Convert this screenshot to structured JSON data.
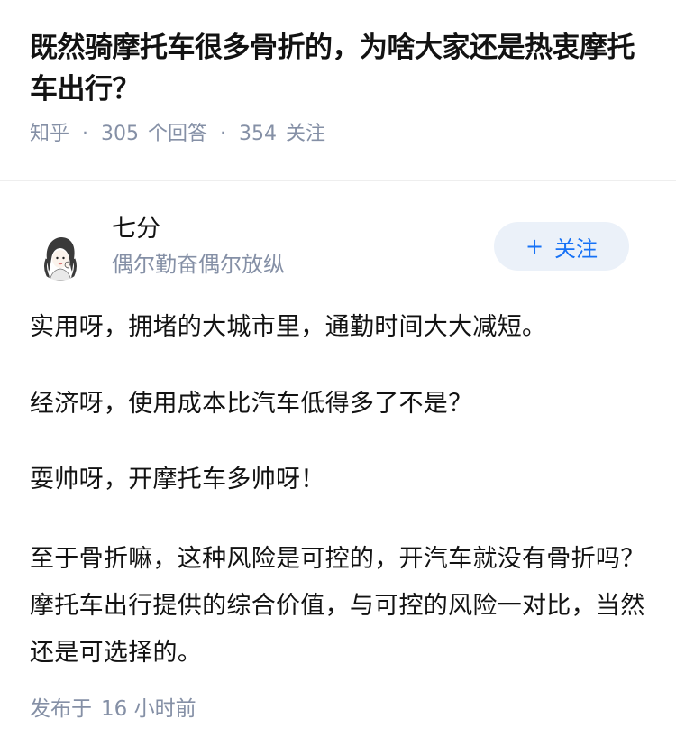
{
  "question": {
    "title": "既然骑摩托车很多骨折的，为啥大家还是热衷摩托车出行？",
    "source": "知乎",
    "answer_count": "305",
    "answer_label": "个回答",
    "follow_count": "354",
    "follow_label": "关注"
  },
  "answer": {
    "author": {
      "name": "七分",
      "bio": "偶尔勤奋偶尔放纵",
      "avatar_icon": "avatar-illustration-icon"
    },
    "follow_button": {
      "plus": "+",
      "label": "关注"
    },
    "paragraphs": [
      "实用呀，拥堵的大城市里，通勤时间大大减短。",
      "经济呀，使用成本比汽车低得多了不是？",
      "耍帅呀，开摩托车多帅呀！",
      "至于骨折嘛，这种风险是可控的，开汽车就没有骨折吗？摩托车出行提供的综合价值，与可控的风险一对比，当然还是可选择的。"
    ],
    "publish": {
      "label": "发布于",
      "time": "16 小时前"
    }
  },
  "colors": {
    "text": "#121212",
    "meta": "#8590a6",
    "accent": "#1772f6",
    "button_bg": "#ebf1f9"
  }
}
